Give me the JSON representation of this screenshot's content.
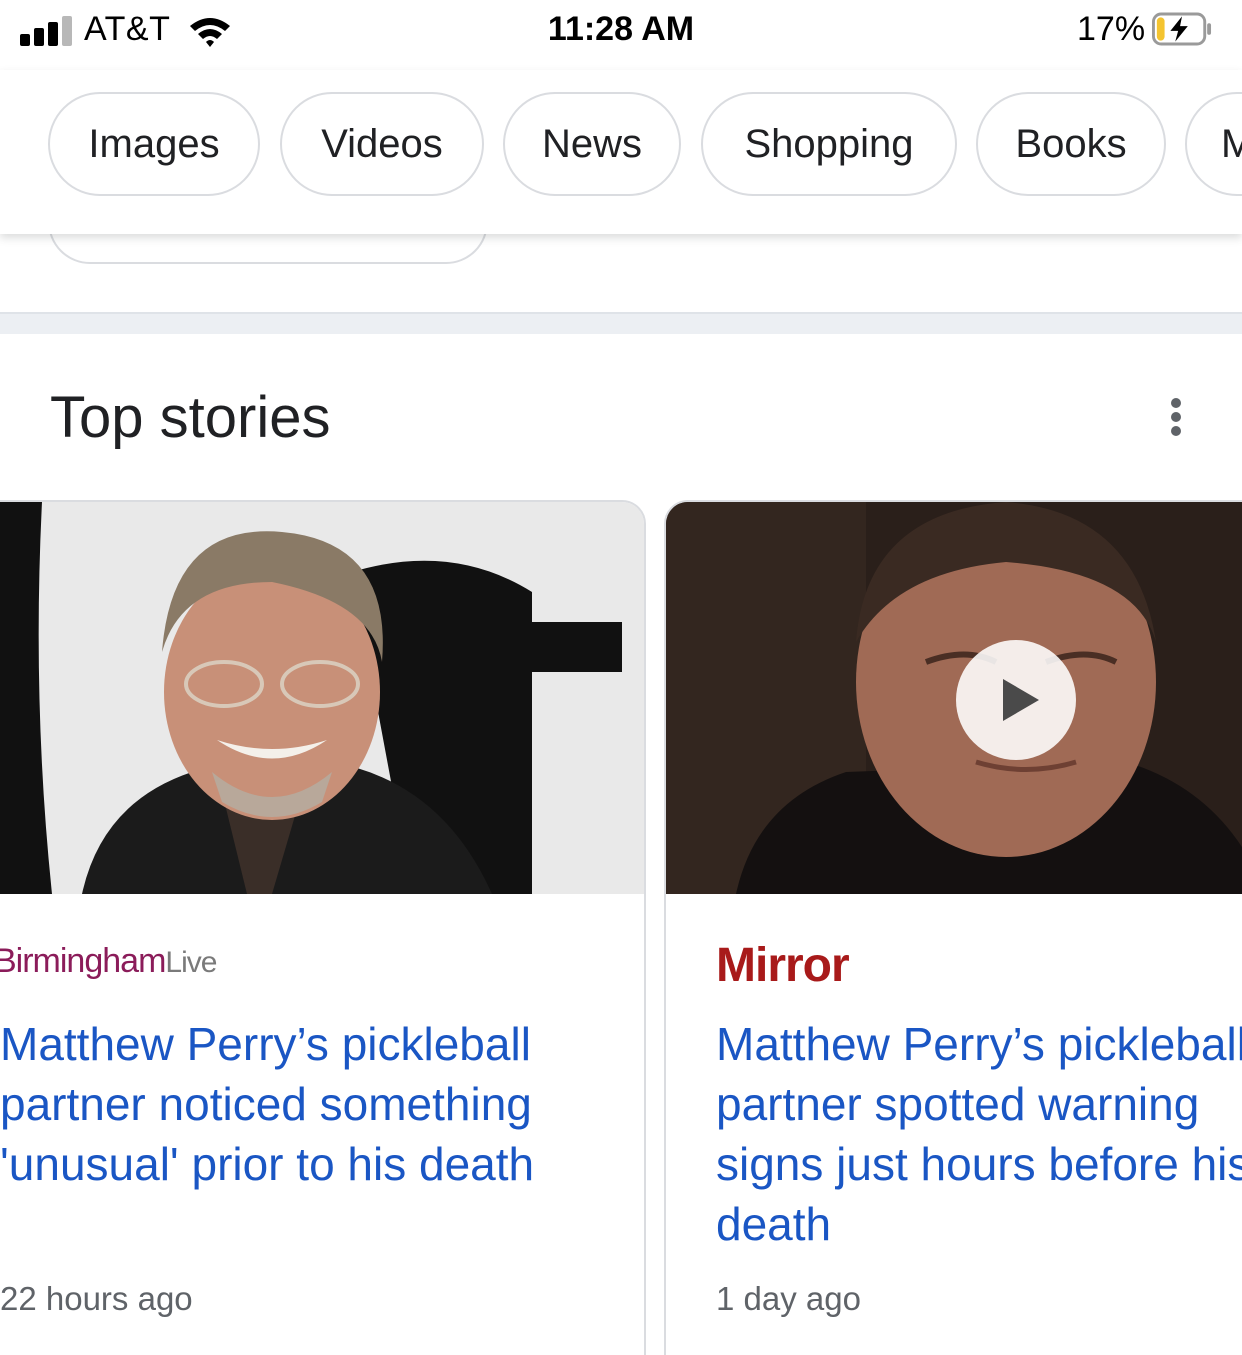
{
  "status_bar": {
    "carrier": "AT&T",
    "time": "11:28 AM",
    "battery_percent": "17%",
    "battery_level": 0.17,
    "charging": true,
    "icons": [
      "signal-icon",
      "wifi-icon",
      "battery-charging-icon"
    ]
  },
  "chips": [
    {
      "label": "Images"
    },
    {
      "label": "Videos"
    },
    {
      "label": "News"
    },
    {
      "label": "Shopping"
    },
    {
      "label": "Books"
    },
    {
      "label": "M"
    }
  ],
  "top_stories": {
    "title": "Top stories",
    "menu_icon": "more-vert-icon",
    "stories": [
      {
        "source": "Birmingham",
        "source_suffix": "Live",
        "headline_lines": [
          "Matthew Perry’s pickleball",
          "partner noticed something",
          "'unusual' prior to his death"
        ],
        "time": "22 hours ago",
        "has_video": false
      },
      {
        "source": "Mirror",
        "headline_lines": [
          "Matthew Perry’s pickleball",
          "partner spotted warning",
          "signs just hours before his",
          "death"
        ],
        "time": "1 day ago",
        "has_video": true
      }
    ]
  },
  "colors": {
    "link": "#1a56c4",
    "mirror_red": "#a81a1a",
    "birmingham_magenta": "#8b1c5a",
    "chip_border": "#dadce0",
    "muted_text": "#5f6368"
  }
}
